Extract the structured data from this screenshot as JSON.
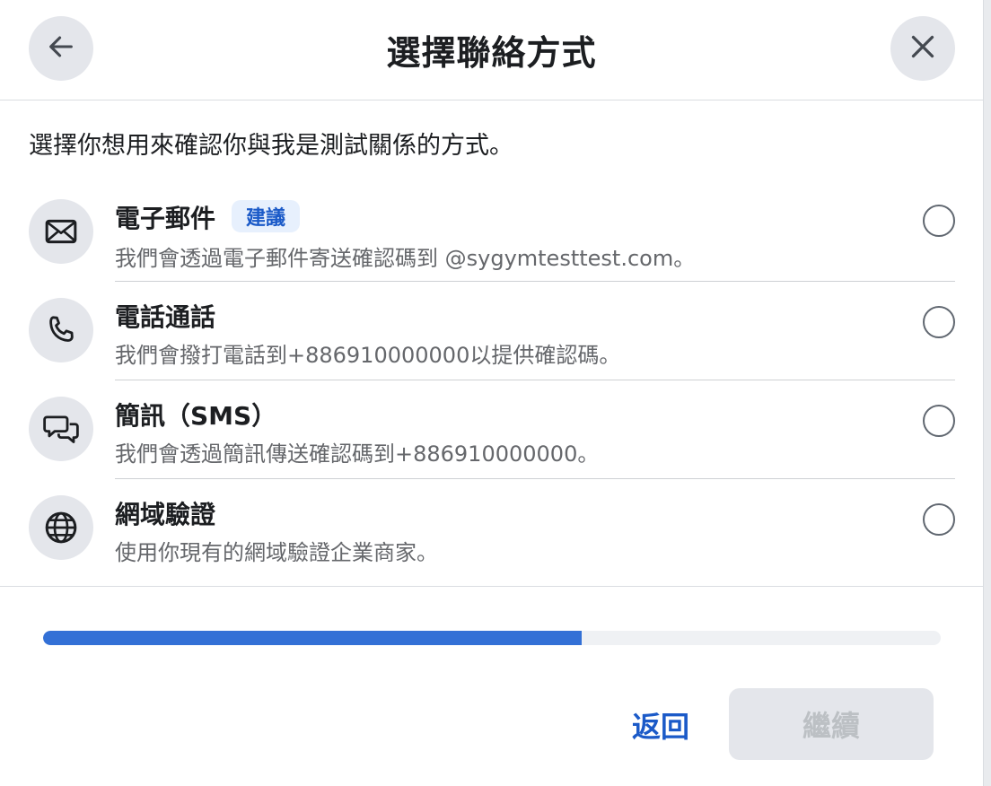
{
  "header": {
    "title": "選擇聯絡方式",
    "back_icon": "arrow-left-icon",
    "close_icon": "close-icon"
  },
  "intro": "選擇你想用來確認你與我是測試關係的方式。",
  "options": [
    {
      "icon": "envelope-icon",
      "title": "電子郵件",
      "badge": "建議",
      "description": "我們會透過電子郵件寄送確認碼到 @sygymtesttest.com。",
      "selected": false
    },
    {
      "icon": "phone-icon",
      "title": "電話通話",
      "description": "我們會撥打電話到+886910000000以提供確認碼。",
      "selected": false
    },
    {
      "icon": "chat-bubbles-icon",
      "title": "簡訊（SMS）",
      "description": "我們會透過簡訊傳送確認碼到+886910000000。",
      "selected": false
    },
    {
      "icon": "globe-icon",
      "title": "網域驗證",
      "description": "使用你現有的網域驗證企業商家。",
      "selected": false
    }
  ],
  "progress": {
    "fraction": 0.6
  },
  "footer": {
    "back_label": "返回",
    "continue_label": "繼續",
    "continue_disabled": true
  },
  "colors": {
    "accent": "#1b5ac8",
    "progress_fill": "#3370d6",
    "button_disabled_bg": "#e4e6eb"
  }
}
